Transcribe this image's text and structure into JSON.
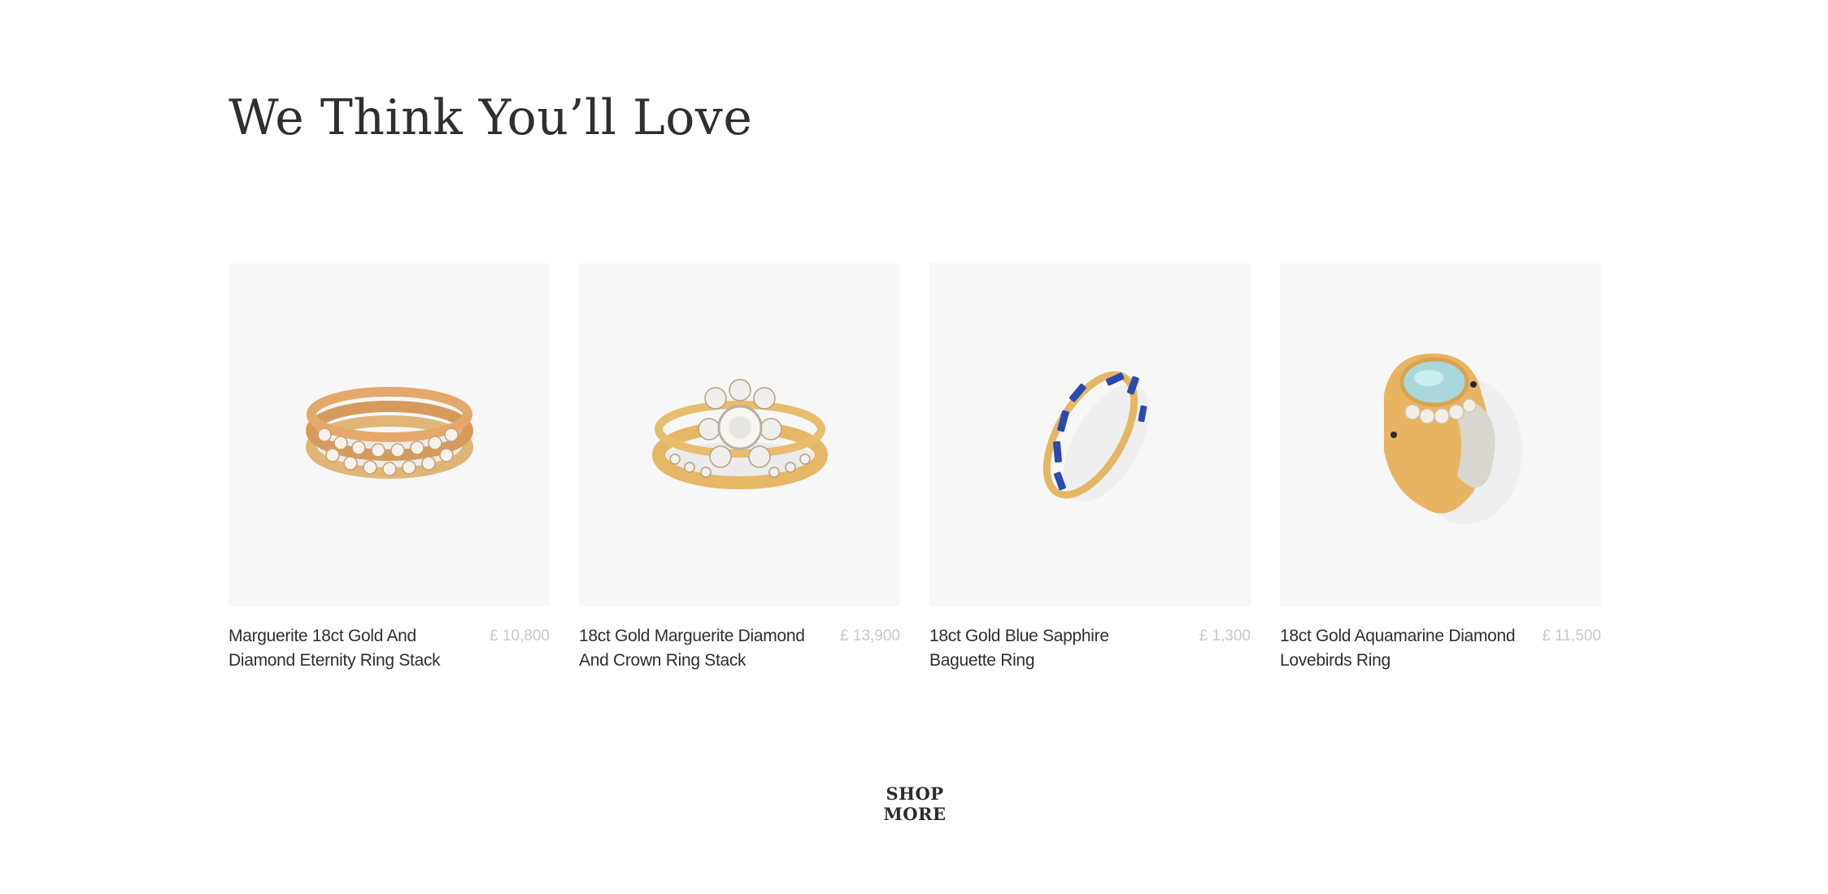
{
  "section": {
    "title": "We Think You’ll Love"
  },
  "products": [
    {
      "name": "Marguerite 18ct Gold And Diamond Eternity Ring Stack",
      "price": "£ 10,800"
    },
    {
      "name": "18ct Gold Marguerite Diamond And Crown Ring Stack",
      "price": "£ 13,900"
    },
    {
      "name": "18ct Gold Blue Sapphire Baguette Ring",
      "price": "£ 1,300"
    },
    {
      "name": "18ct Gold Aquamarine Diamond Lovebirds Ring",
      "price": "£ 11,500"
    }
  ],
  "cta": {
    "label": "SHOP MORE"
  },
  "colors": {
    "image_bg": "#f7f7f7",
    "price": "#c8c8c8",
    "gold": "#e3b465",
    "sapphire": "#2a4ab0",
    "aquamarine": "#a8d8dc"
  }
}
